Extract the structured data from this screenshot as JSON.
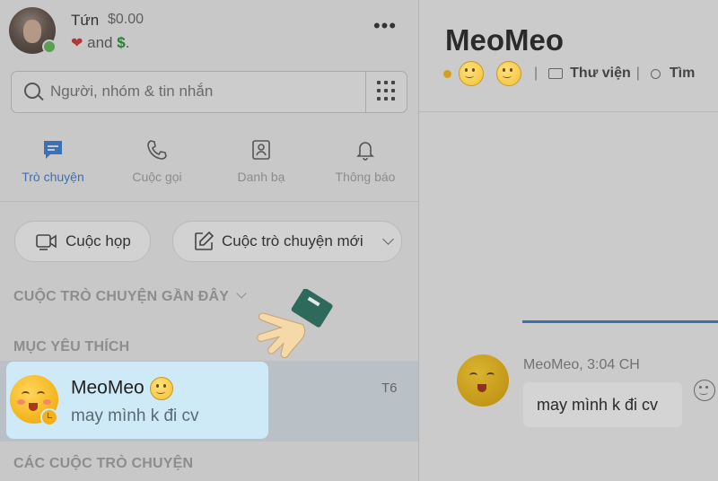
{
  "profile": {
    "name": "Tứn",
    "credit": "$0.00",
    "mood_and": "and",
    "mood_heart": "❤",
    "mood_dollar": "$",
    "mood_period": "."
  },
  "search": {
    "placeholder": "Người, nhóm & tin nhắn"
  },
  "nav": {
    "tabs": [
      {
        "label": "Trò chuyện",
        "icon": "chat-icon",
        "active": true
      },
      {
        "label": "Cuộc gọi",
        "icon": "phone-icon",
        "active": false
      },
      {
        "label": "Danh bạ",
        "icon": "contacts-icon",
        "active": false
      },
      {
        "label": "Thông báo",
        "icon": "bell-icon",
        "active": false
      }
    ]
  },
  "actions": {
    "meeting": "Cuộc họp",
    "new_chat": "Cuộc trò chuyện mới"
  },
  "sections": {
    "recent": "CUỘC TRÒ CHUYỆN GẦN ĐÂY",
    "favorites": "MỤC YÊU THÍCH",
    "conversations": "CÁC CUỘC TRÒ CHUYỆN"
  },
  "chat_item": {
    "name": "MeoMeo",
    "last_message": "may mình k đi cv",
    "date": "T6"
  },
  "conversation": {
    "title": "MeoMeo",
    "gallery": "Thư viện",
    "find": "Tìm",
    "sender_time": "MeoMeo, 3:04 CH",
    "message": "may mình k đi cv"
  },
  "colors": {
    "accent": "#3a72b5",
    "highlight": "#cdeaf6",
    "overlay": "#c8c8c8"
  }
}
